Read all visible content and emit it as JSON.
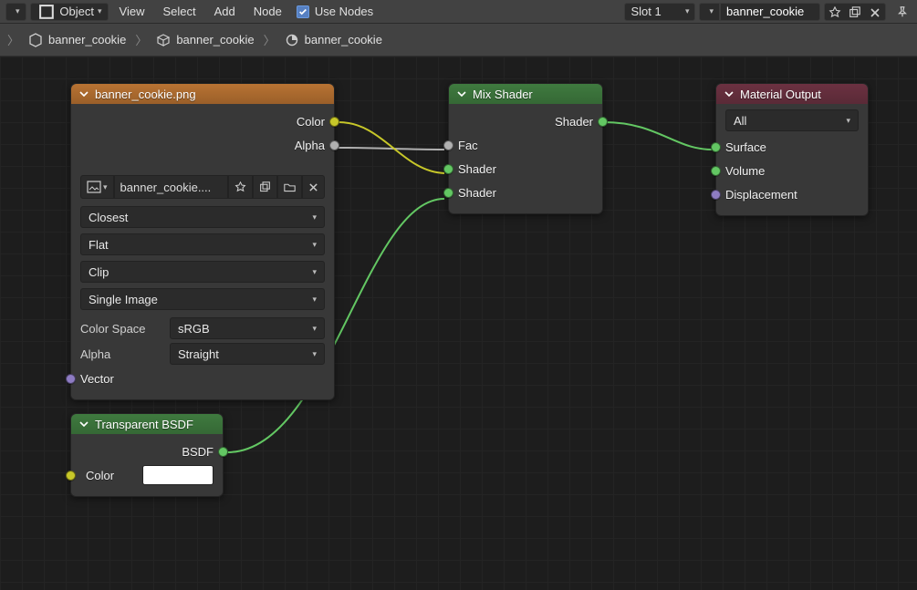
{
  "header": {
    "mode_label": "Object",
    "menu_view": "View",
    "menu_select": "Select",
    "menu_add": "Add",
    "menu_node": "Node",
    "use_nodes_label": "Use Nodes",
    "slot_label": "Slot 1",
    "material_name": "banner_cookie"
  },
  "breadcrumb": {
    "item1": "banner_cookie",
    "item2": "banner_cookie",
    "item3": "banner_cookie"
  },
  "nodes": {
    "image_texture": {
      "title": "banner_cookie.png",
      "out_color": "Color",
      "out_alpha": "Alpha",
      "image_name": "banner_cookie....",
      "interp": "Closest",
      "projection": "Flat",
      "extension": "Clip",
      "source": "Single Image",
      "colorspace_label": "Color Space",
      "colorspace_value": "sRGB",
      "alpha_label": "Alpha",
      "alpha_value": "Straight",
      "in_vector": "Vector"
    },
    "mix_shader": {
      "title": "Mix Shader",
      "out_shader": "Shader",
      "in_fac": "Fac",
      "in_shader1": "Shader",
      "in_shader2": "Shader"
    },
    "material_output": {
      "title": "Material Output",
      "target": "All",
      "in_surface": "Surface",
      "in_volume": "Volume",
      "in_displacement": "Displacement"
    },
    "transparent": {
      "title": "Transparent BSDF",
      "out_bsdf": "BSDF",
      "in_color": "Color"
    }
  }
}
